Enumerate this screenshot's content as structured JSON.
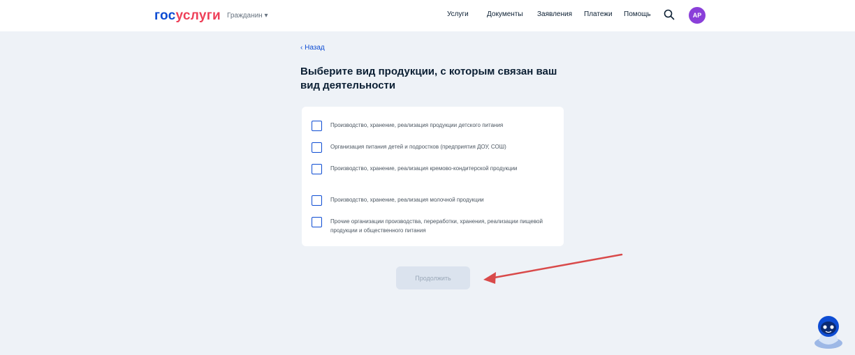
{
  "header": {
    "logo": {
      "part1": "гос",
      "part2": "услуги"
    },
    "region_label": "Гражданин ▾",
    "nav": [
      "Услуги",
      "Документы",
      "Заявления",
      "Платежи",
      "Помощь"
    ],
    "avatar_initials": "АР",
    "colors": {
      "brand_blue": "#0d4cd3",
      "brand_red": "#ee3f58",
      "avatar": "#8a3fd9"
    }
  },
  "page": {
    "back_link": "‹ Назад",
    "title": "Выберите вид продукции, с которым связан ваш вид деятельности",
    "options": [
      "Производство, хранение, реализация продукции детского питания",
      "Организация питания детей и подростков (предприятия ДОУ, СОШ)",
      "Производство, хранение, реализация кремово-кондитерской продукции",
      "Производство, хранение, реализация молочной продукции",
      "Прочие организации производства, переработки, хранения, реализации пищевой продукции и общественного питания"
    ],
    "submit_label": "Продолжить"
  },
  "annotation": {
    "arrow_color": "#d94a4a"
  },
  "assistant_icon": "robot-assistant-icon"
}
